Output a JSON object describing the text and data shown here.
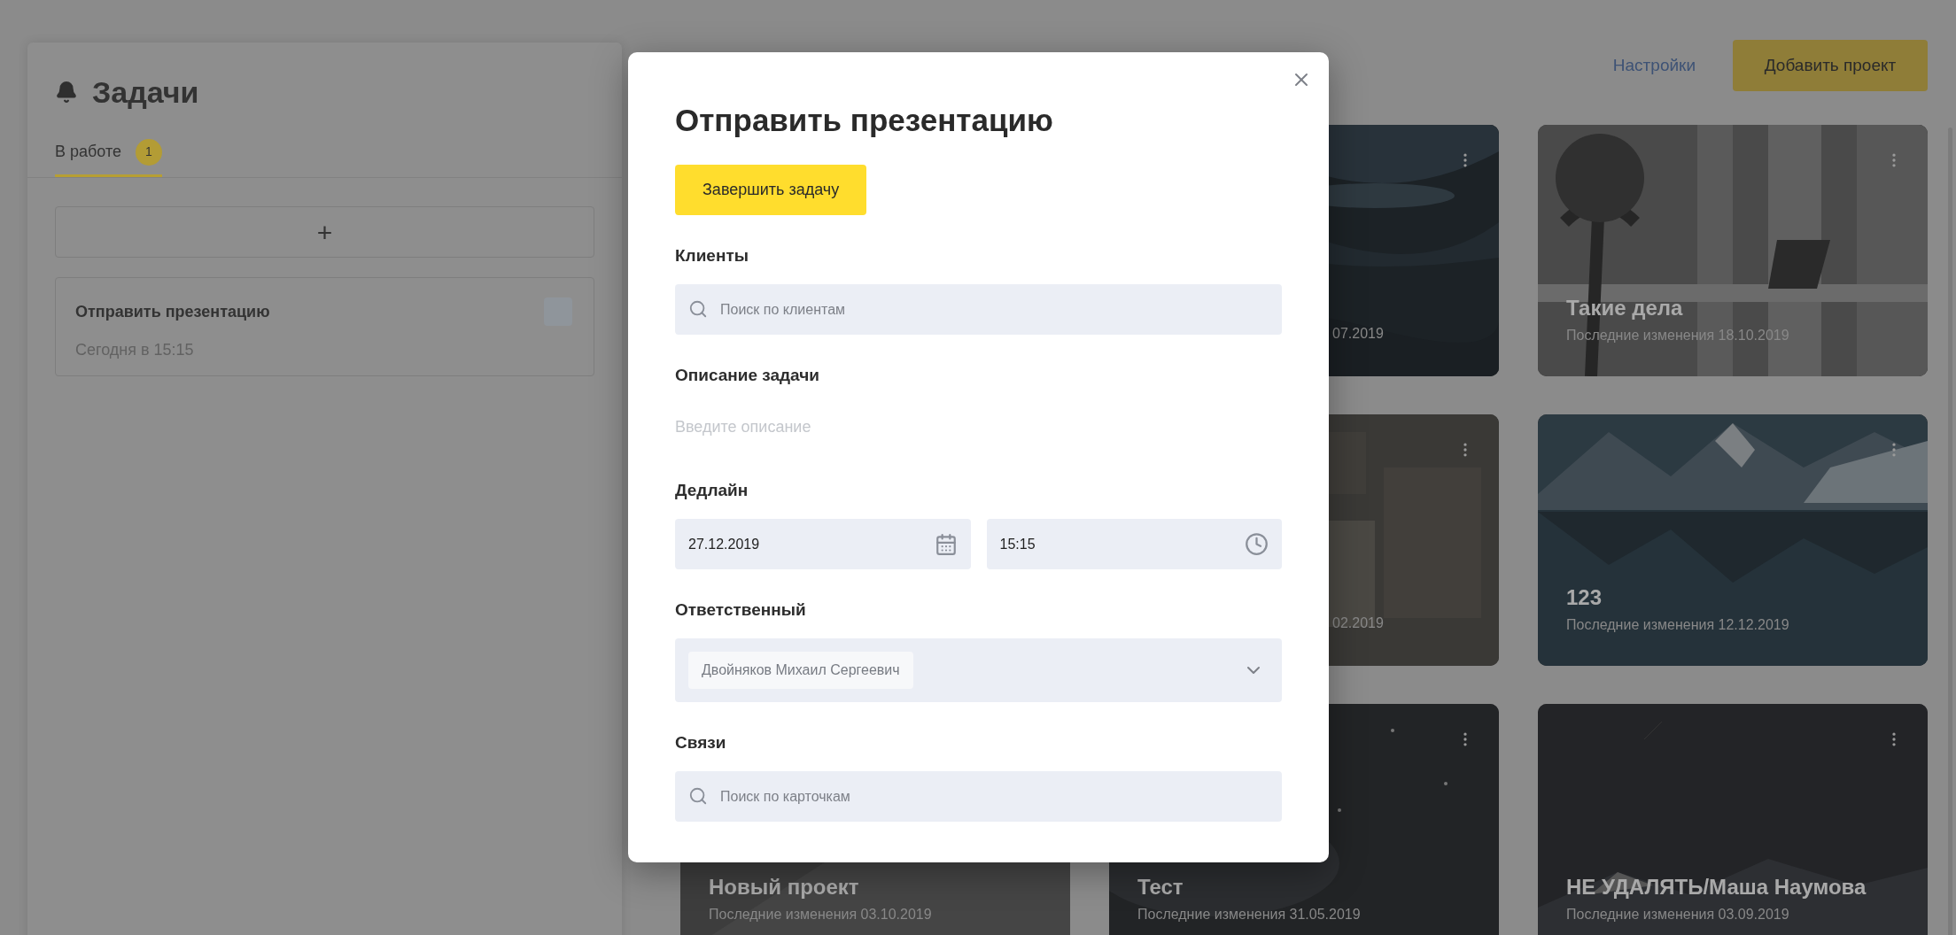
{
  "sidebar": {
    "title": "Задачи",
    "tabs": [
      {
        "label": "В работе",
        "count": "1",
        "selected": true
      }
    ],
    "add_button": "+",
    "tasks": [
      {
        "title": "Отправить презентацию",
        "due": "Сегодня в 15:15",
        "checked": false
      }
    ]
  },
  "header": {
    "settings_link": "Настройки",
    "add_project_button": "Добавить проект"
  },
  "projects": [
    {
      "kind": "partial",
      "date": "07.2019"
    },
    {
      "kind": "full",
      "title": "Такие дела",
      "date": "Последние изменения 18.10.2019"
    },
    {
      "kind": "partial",
      "date": "02.2019"
    },
    {
      "kind": "full",
      "title": "123",
      "date": "Последние изменения 12.12.2019"
    },
    {
      "kind": "full",
      "menu": false,
      "title": "Новый проект",
      "date": "Последние изменения 03.10.2019"
    },
    {
      "kind": "full",
      "title": "Тест",
      "date": "Последние изменения 31.05.2019"
    },
    {
      "kind": "full",
      "title": "НЕ УДАЛЯТЬ/Маша Наумова",
      "date": "Последние изменения 03.09.2019"
    }
  ],
  "dialog": {
    "title": "Отправить презентацию",
    "complete_button": "Завершить задачу",
    "fields": [
      {
        "kind": "search",
        "label": "Клиенты",
        "placeholder": "Поиск по клиентам"
      },
      {
        "kind": "text",
        "label": "Описание задачи",
        "placeholder": "Введите описание"
      },
      {
        "kind": "datetime",
        "label": "Дедлайн",
        "date": "27.12.2019",
        "time": "15:15"
      },
      {
        "kind": "select",
        "label": "Ответственный",
        "chips": [
          "Двойняков Михаил Сергеевич"
        ]
      },
      {
        "kind": "search",
        "label": "Связи",
        "placeholder": "Поиск по карточкам"
      }
    ]
  }
}
